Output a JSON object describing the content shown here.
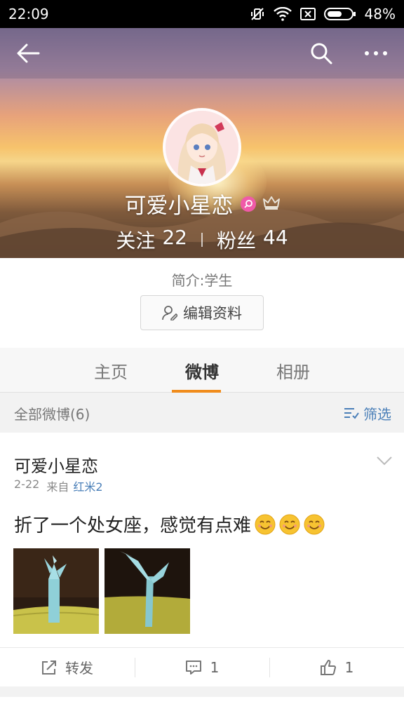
{
  "status_bar": {
    "time": "22:09",
    "battery_percent": "48%"
  },
  "profile": {
    "name": "可爱小星恋",
    "following_label": "关注",
    "following_count": "22",
    "followers_label": "粉丝",
    "followers_count": "44",
    "bio": "简介:学生",
    "edit_button": "编辑资料"
  },
  "tabs": [
    {
      "label": "主页",
      "active": false
    },
    {
      "label": "微博",
      "active": true
    },
    {
      "label": "相册",
      "active": false
    }
  ],
  "filter": {
    "label": "全部微博(6)",
    "button": "筛选"
  },
  "post": {
    "author": "可爱小星恋",
    "date": "2-22",
    "source_prefix": "来自",
    "source": "红米2",
    "text": "折了一个处女座，感觉有点难",
    "emoji_count": 3,
    "actions": {
      "repost_label": "转发",
      "comment_count": "1",
      "like_count": "1"
    }
  },
  "colors": {
    "accent_orange": "#f08c1c",
    "link_blue": "#4a7fb8",
    "badge_pink": "#f05aa8"
  }
}
